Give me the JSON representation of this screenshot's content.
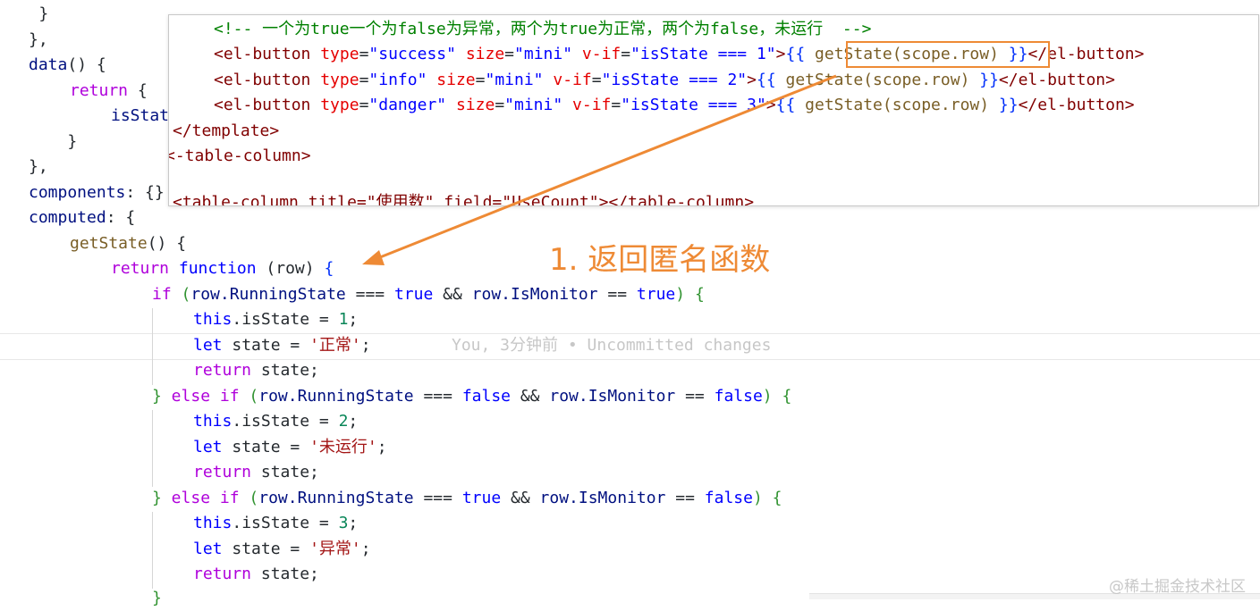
{
  "editor": {
    "lines": {
      "l1": {
        "text": "    }"
      },
      "l2": {
        "text": "},"
      },
      "l3": {
        "name": "data",
        "rest": "() {"
      },
      "l4": {
        "kw": "return",
        "rest": " {"
      },
      "l5": {
        "text": "isStat"
      },
      "l6": {
        "text": "    }"
      },
      "l7": {
        "text": "},"
      },
      "l8": {
        "name": "components",
        "rest": ": {}"
      },
      "l9": {
        "name": "computed",
        "rest": ": {"
      },
      "l10": {
        "name": "getState",
        "rest": "() {"
      },
      "l11": {
        "kw": "return",
        "fn": "function",
        "param": "(row)",
        "brace": "{"
      },
      "l12": {
        "kw": "if",
        "open": "(",
        "obj1": "row.RunningState",
        "op1": " === ",
        "v1": "true",
        "op2": " && ",
        "obj2": "row.IsMonitor",
        "op3": " == ",
        "v2": "true",
        "close": ")",
        "brace": " {"
      },
      "l13": {
        "kw": "this",
        "rest": ".isState = ",
        "num": "1",
        "end": ";"
      },
      "l14": {
        "kw": "let",
        "rest": " state = ",
        "str": "'正常'",
        "end": ";"
      },
      "l15": {
        "kw": "return",
        "rest": " state;"
      },
      "l16": {
        "close": "}",
        "kw": " else if",
        "open": " (",
        "obj1": "row.RunningState",
        "op1": " === ",
        "v1": "false",
        "op2": " && ",
        "obj2": "row.IsMonitor",
        "op3": " == ",
        "v2": "false",
        "close2": ")",
        "brace": " {"
      },
      "l17": {
        "kw": "this",
        "rest": ".isState = ",
        "num": "2",
        "end": ";"
      },
      "l18": {
        "kw": "let",
        "rest": " state = ",
        "str": "'未运行'",
        "end": ";"
      },
      "l19": {
        "kw": "return",
        "rest": " state;"
      },
      "l20": {
        "close": "}",
        "kw": " else if",
        "open": " (",
        "obj1": "row.RunningState",
        "op1": " === ",
        "v1": "true",
        "op2": " && ",
        "obj2": "row.IsMonitor",
        "op3": " == ",
        "v2": "false",
        "close2": ")",
        "brace": " {"
      },
      "l21": {
        "kw": "this",
        "rest": ".isState = ",
        "num": "3",
        "end": ";"
      },
      "l22": {
        "kw": "let",
        "rest": " state = ",
        "str": "'异常'",
        "end": ";"
      },
      "l23": {
        "kw": "return",
        "rest": " state;"
      },
      "l24": {
        "text": "}"
      }
    },
    "blame": "You, 3分钟前 • Uncommitted changes"
  },
  "overlay": {
    "comment": "<!-- 一个为true一个为false为异常，两个为true为正常，两个为false，未运行  -->",
    "buttons": [
      {
        "tag_open": "<el-button",
        "type_attr": "type",
        "type_val": "\"success\"",
        "size_attr": "size",
        "size_val": "\"mini\"",
        "vif_attr": "v-if",
        "vif_val": "\"isState === 1\"",
        "expr": "getState(scope.row)",
        "tag_close": "</el-button>"
      },
      {
        "tag_open": "<el-button",
        "type_attr": "type",
        "type_val": "\"info\"",
        "size_attr": "size",
        "size_val": "\"mini\"",
        "vif_attr": "v-if",
        "vif_val": "\"isState === 2\"",
        "expr": "getState(scope.row)",
        "tag_close": "</el-button>"
      },
      {
        "tag_open": "<el-button",
        "type_attr": "type",
        "type_val": "\"danger\"",
        "size_attr": "size",
        "size_val": "\"mini\"",
        "vif_attr": "v-if",
        "vif_val": "\"isState === 3\"",
        "expr": "getState(scope.row)",
        "tag_close": "</el-button>"
      }
    ],
    "template_close": "</template>",
    "column_close": "<-table-column>",
    "cut_line": "<table-column title=\"使用数\" field=\"UseCount\"></table-column>"
  },
  "annotation": "1. 返回匿名函数",
  "watermark": "@稀土掘金技术社区",
  "colors": {
    "accent": "#ee8a35"
  }
}
